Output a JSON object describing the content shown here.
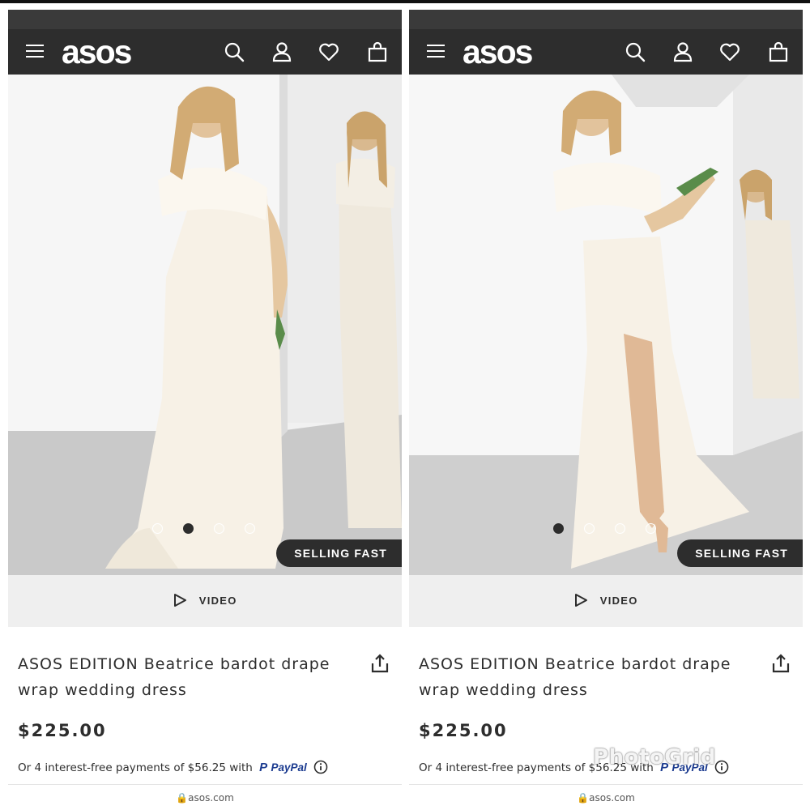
{
  "collage": {
    "watermark": "PhotoGrid"
  },
  "panels": [
    {
      "header": {
        "logo": "asos",
        "icons": [
          "menu-icon",
          "search-icon",
          "account-icon",
          "heart-icon",
          "bag-icon"
        ]
      },
      "gallery": {
        "image_count": 4,
        "active_index": 1,
        "badge": "SELLING FAST"
      },
      "video": {
        "label": "VIDEO"
      },
      "product": {
        "title": "ASOS EDITION Beatrice bardot drape wrap wedding dress",
        "price": "$225.00",
        "installments_text": "Or 4 interest-free payments of $56.25 with",
        "paypal_label": "PayPal"
      },
      "browser": {
        "url": "asos.com"
      }
    },
    {
      "header": {
        "logo": "asos",
        "icons": [
          "menu-icon",
          "search-icon",
          "account-icon",
          "heart-icon",
          "bag-icon"
        ]
      },
      "gallery": {
        "image_count": 4,
        "active_index": 0,
        "badge": "SELLING FAST"
      },
      "video": {
        "label": "VIDEO"
      },
      "product": {
        "title": "ASOS EDITION Beatrice bardot drape wrap wedding dress",
        "price": "$225.00",
        "installments_text": "Or 4 interest-free payments of $56.25 with",
        "paypal_label": "PayPal"
      },
      "browser": {
        "url": "asos.com"
      }
    }
  ],
  "colors": {
    "header_bg": "#2d2d2d",
    "text": "#2d2d2d",
    "video_bar_bg": "#efefef",
    "paypal_blue": "#1a3a8f",
    "dress": "#f7f1e6"
  }
}
